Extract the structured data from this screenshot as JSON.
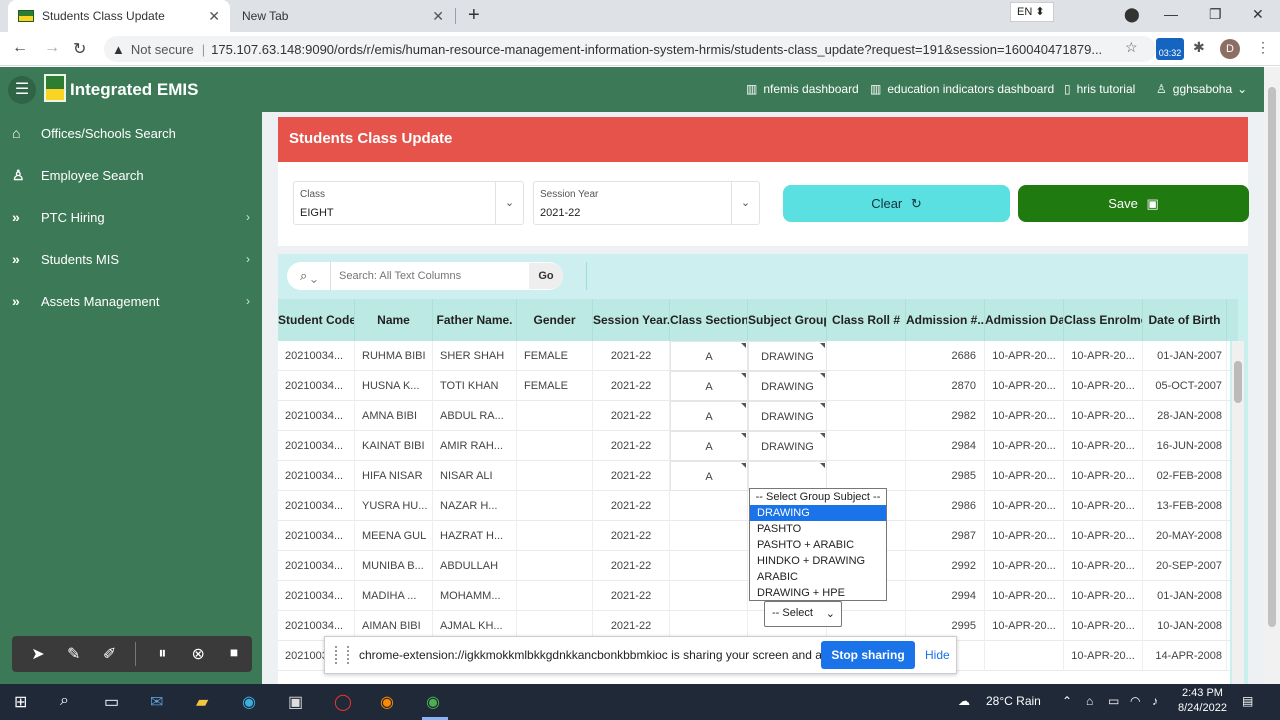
{
  "browser": {
    "tabs": [
      {
        "title": "Students Class Update",
        "close": "✕"
      },
      {
        "title": "New Tab",
        "close": "✕"
      }
    ],
    "new_tab": "+",
    "lang": "EN ⬍",
    "security": "Not secure",
    "url": "175.107.63.148:9090/ords/r/emis/human-resource-management-information-system-hrmis/students-class_update?request=191&session=160040471879...",
    "profile_initial": "D",
    "record_time": "03:32"
  },
  "app": {
    "title": "Integrated EMIS",
    "header_links": [
      {
        "label": "nfemis dashboard"
      },
      {
        "label": "education indicators dashboard"
      },
      {
        "label": "hris tutorial"
      },
      {
        "label": "gghsaboha"
      }
    ]
  },
  "sidebar": {
    "items": [
      {
        "label": "Offices/Schools Search",
        "icon": "⌂"
      },
      {
        "label": "Employee Search",
        "icon": "♙"
      },
      {
        "label": "PTC Hiring",
        "icon": "»",
        "chevron": "›"
      },
      {
        "label": "Students MIS",
        "icon": "»",
        "chevron": "›"
      },
      {
        "label": "Assets Management",
        "icon": "»",
        "chevron": "›"
      }
    ]
  },
  "page": {
    "title": "Students Class Update",
    "class_label": "Class",
    "class_value": "EIGHT",
    "session_label": "Session Year",
    "session_value": "2021-22",
    "clear_label": "Clear",
    "save_label": "Save"
  },
  "grid": {
    "search_placeholder": "Search: All Text Columns",
    "go_label": "Go",
    "columns": [
      "Student Code",
      "Name",
      "Father Name.",
      "Gender",
      "Session Year..",
      "Class Section..",
      "Subject Group",
      "Class Roll #",
      "Admission #..",
      "Admission Date",
      "Class Enrolment",
      "Date of Birth"
    ],
    "rows": [
      [
        "20210034...",
        "RUHMA BIBI",
        "SHER SHAH",
        "FEMALE",
        "2021-22",
        "A",
        "DRAWING",
        "",
        "2686",
        "10-APR-20...",
        "10-APR-20...",
        "01-JAN-2007"
      ],
      [
        "20210034...",
        "HUSNA K...",
        "TOTI KHAN",
        "FEMALE",
        "2021-22",
        "A",
        "DRAWING",
        "",
        "2870",
        "10-APR-20...",
        "10-APR-20...",
        "05-OCT-2007"
      ],
      [
        "20210034...",
        "AMNA BIBI",
        "ABDUL RA...",
        "",
        "2021-22",
        "A",
        "DRAWING",
        "",
        "2982",
        "10-APR-20...",
        "10-APR-20...",
        "28-JAN-2008"
      ],
      [
        "20210034...",
        "KAINAT BIBI",
        "AMIR RAH...",
        "",
        "2021-22",
        "A",
        "DRAWING",
        "",
        "2984",
        "10-APR-20...",
        "10-APR-20...",
        "16-JUN-2008"
      ],
      [
        "20210034...",
        "HIFA NISAR",
        "NISAR ALI",
        "",
        "2021-22",
        "A",
        "",
        "",
        "2985",
        "10-APR-20...",
        "10-APR-20...",
        "02-FEB-2008"
      ],
      [
        "20210034...",
        "YUSRA HU...",
        "NAZAR H...",
        "",
        "2021-22",
        "",
        "",
        "",
        "2986",
        "10-APR-20...",
        "10-APR-20...",
        "13-FEB-2008"
      ],
      [
        "20210034...",
        "MEENA GUL",
        "HAZRAT H...",
        "",
        "2021-22",
        "",
        "",
        "",
        "2987",
        "10-APR-20...",
        "10-APR-20...",
        "20-MAY-2008"
      ],
      [
        "20210034...",
        "MUNIBA B...",
        "ABDULLAH",
        "",
        "2021-22",
        "",
        "",
        "",
        "2992",
        "10-APR-20...",
        "10-APR-20...",
        "20-SEP-2007"
      ],
      [
        "20210034...",
        "MADIHA ...",
        "MOHAMM...",
        "",
        "2021-22",
        "",
        "",
        "",
        "2994",
        "10-APR-20...",
        "10-APR-20...",
        "01-JAN-2008"
      ],
      [
        "20210034...",
        "AIMAN BIBI",
        "AJMAL KH...",
        "",
        "2021-22",
        "",
        "",
        "",
        "2995",
        "10-APR-20...",
        "10-APR-20...",
        "10-JAN-2008"
      ],
      [
        "2021003",
        "",
        "",
        "",
        "",
        "",
        "",
        "",
        "",
        "",
        "10-APR-20...",
        "14-APR-2008"
      ]
    ],
    "inline_select": "-- Select",
    "dropdown_options": [
      "-- Select Group Subject --",
      "DRAWING",
      "PASHTO",
      "PASHTO + ARABIC",
      "HINDKO + DRAWING",
      "ARABIC",
      "DRAWING + HPE"
    ],
    "dropdown_highlight": "DRAWING"
  },
  "share_bar": {
    "message": "chrome-extension://igkkmokkmlbkkgdnkkancbonkbbmkioc is sharing your screen and audio.",
    "stop_label": "Stop sharing",
    "hide_label": "Hide"
  },
  "taskbar": {
    "weather": "28°C Rain",
    "time": "2:43 PM",
    "date": "8/24/2022"
  },
  "colors": {
    "header_green": "#3c7a57",
    "title_red": "#e5534b",
    "clear_cyan": "#5ae0e0",
    "save_green": "#1f7a10",
    "grid_teal": "#bde9e4"
  }
}
